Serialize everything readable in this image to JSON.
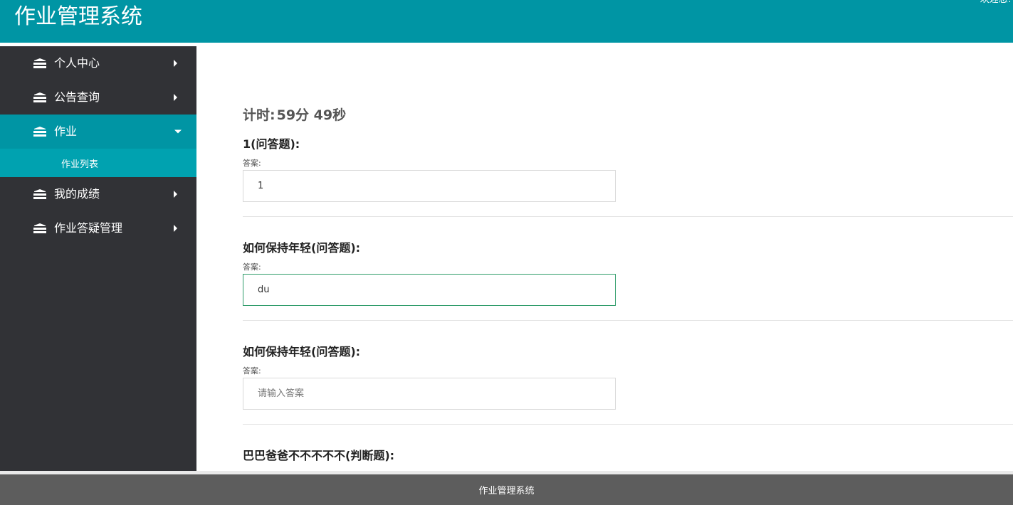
{
  "header": {
    "title": "作业管理系统",
    "welcome": "欢迎您!"
  },
  "sidebar": {
    "items": [
      {
        "label": "个人中心",
        "icon": "stack-icon",
        "expanded": false
      },
      {
        "label": "公告查询",
        "icon": "stack-icon",
        "expanded": false
      },
      {
        "label": "作业",
        "icon": "stack-icon",
        "expanded": true,
        "active": true
      },
      {
        "label": "我的成绩",
        "icon": "stack-icon",
        "expanded": false
      },
      {
        "label": "作业答疑管理",
        "icon": "stack-icon",
        "expanded": false
      }
    ],
    "submenu": [
      {
        "label": "作业列表"
      }
    ]
  },
  "main": {
    "timer_label": "计时:",
    "timer_value": "59分 49秒",
    "questions": [
      {
        "title": "1(问答题):",
        "answer_label": "答案:",
        "value": "1",
        "placeholder": "请输入答案"
      },
      {
        "title": "如何保持年轻(问答题):",
        "answer_label": "答案:",
        "value": "du",
        "placeholder": "请输入答案"
      },
      {
        "title": "如何保持年轻(问答题):",
        "answer_label": "答案:",
        "value": "",
        "placeholder": "请输入答案"
      },
      {
        "title": "巴巴爸爸不不不不不(判断题):"
      }
    ]
  },
  "footer": {
    "text": "作业管理系统"
  },
  "colors": {
    "header_bg": "#0095a4",
    "sidebar_bg": "#313236",
    "active_item_bg": "#0095a4",
    "submenu_bg": "#00a2b0",
    "footer_bg": "#5d5d5d",
    "focus_border": "#2f9c6a"
  }
}
